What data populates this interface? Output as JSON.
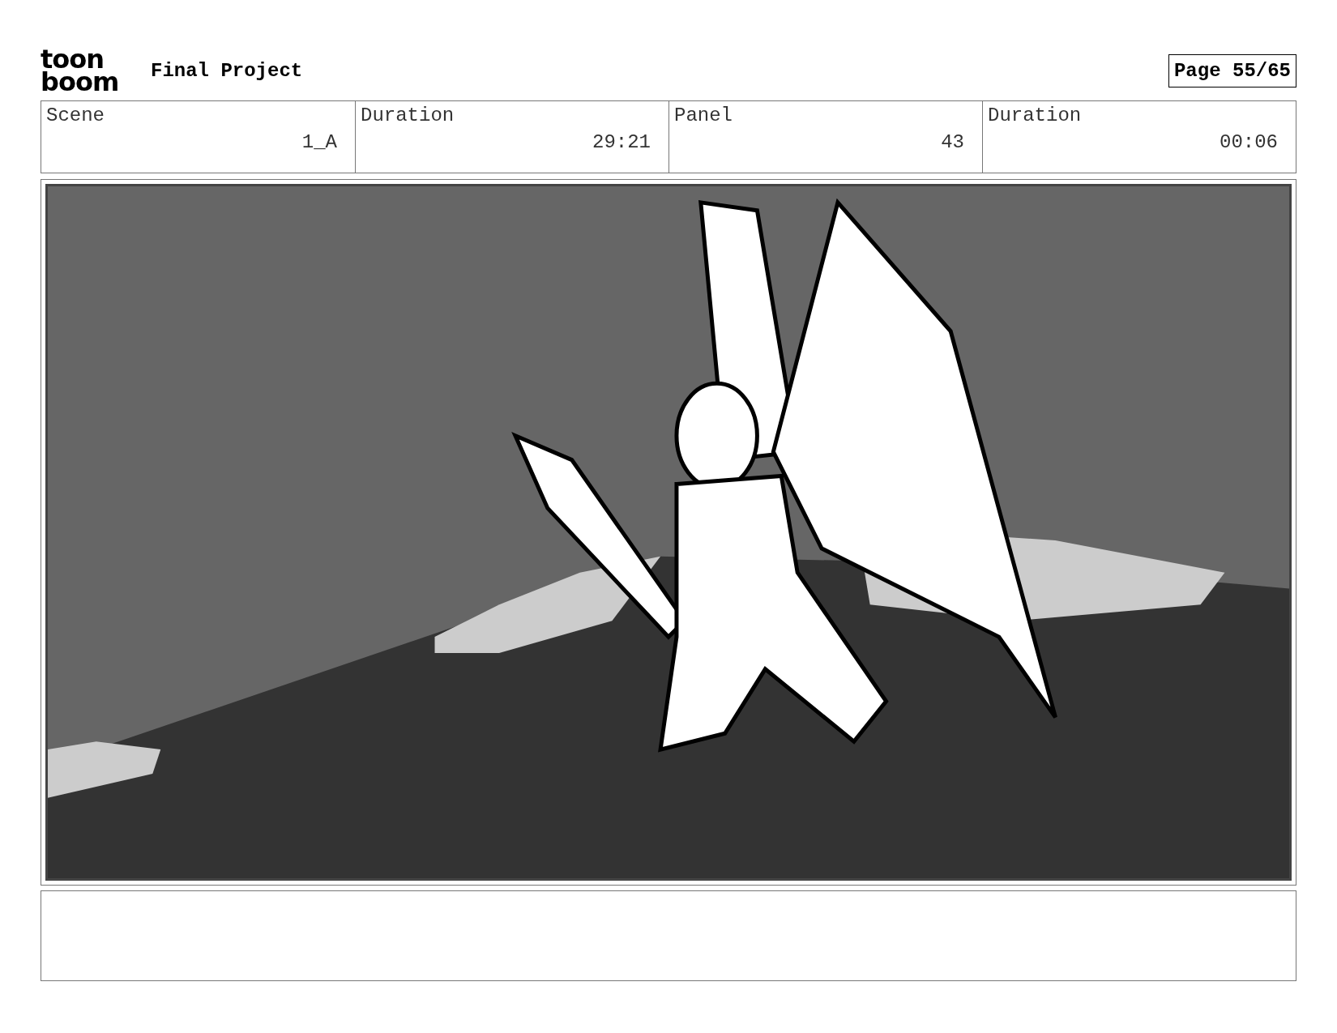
{
  "header": {
    "logo": [
      "toon",
      "boom"
    ],
    "title": "Final Project",
    "page": "Page 55/65"
  },
  "info": [
    {
      "label": "Scene",
      "value": "1_A"
    },
    {
      "label": "Duration",
      "value": "29:21"
    },
    {
      "label": "Panel",
      "value": "43"
    },
    {
      "label": "Duration",
      "value": "00:06"
    }
  ]
}
